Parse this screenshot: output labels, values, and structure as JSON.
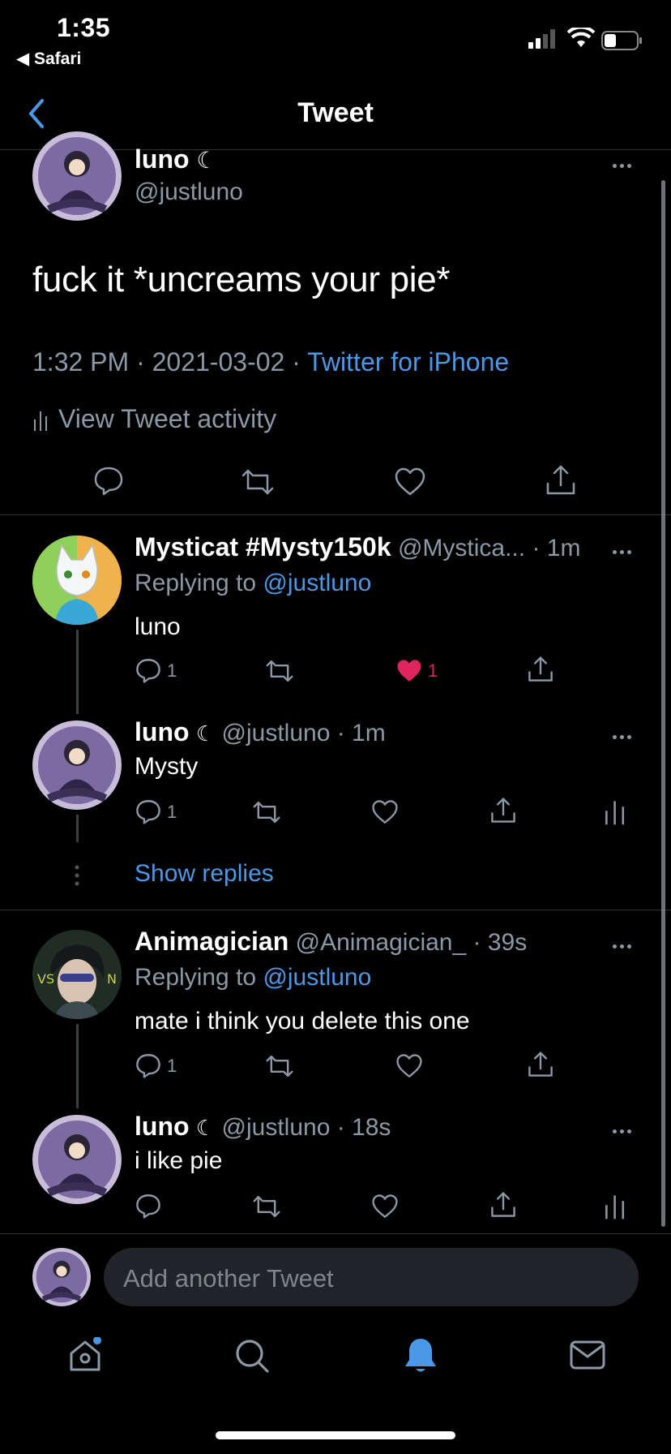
{
  "status_bar": {
    "time": "1:35",
    "back_app": "Safari"
  },
  "nav": {
    "title": "Tweet"
  },
  "main_tweet": {
    "display_name": "luno",
    "handle": "@justluno",
    "text": "fuck it *uncreams your pie*",
    "time": "1:32 PM",
    "date": "2021-03-02",
    "separator": "·",
    "source": "Twitter for iPhone",
    "activity_label": "View Tweet activity"
  },
  "replies": [
    {
      "display_name": "Mysticat #Mysty150k",
      "handle": "@Mystica...",
      "age": "· 1m",
      "replying_prefix": "Replying to",
      "replying_to": "@justluno",
      "text": "luno",
      "reply_count": "1",
      "like_count": "1"
    },
    {
      "display_name": "luno",
      "handle": "@justluno",
      "age": "· 1m",
      "text": "Mysty",
      "reply_count": "1"
    },
    {
      "display_name": "Animagician",
      "handle": "@Animagician_",
      "age": "· 39s",
      "replying_prefix": "Replying to",
      "replying_to": "@justluno",
      "text": "mate i think you delete this one",
      "reply_count": "1"
    },
    {
      "display_name": "luno",
      "handle": "@justluno",
      "age": "· 18s",
      "text": "i like pie"
    }
  ],
  "show_replies_label": "Show replies",
  "composer": {
    "placeholder": "Add another Tweet"
  },
  "colors": {
    "accent": "#4a99e9",
    "like": "#e0245e",
    "background": "#000000",
    "secondary_text": "#8b98a5"
  }
}
